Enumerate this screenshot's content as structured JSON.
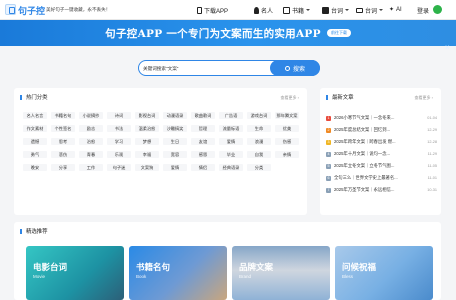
{
  "header": {
    "logo_text": "句子控",
    "tagline": "美好句子一键收藏，永不丢失！",
    "nav": {
      "download": "下载APP",
      "names": "名人",
      "books": "书籍",
      "taici": "台词",
      "taiwen": "台词",
      "ai": "AI",
      "login": "登录"
    }
  },
  "banner": {
    "title": "句子控APP 一个专门为文案而生的实用APP",
    "button": "前往下载",
    "close": "×"
  },
  "search": {
    "value": "关键词搜索\"文案\"",
    "button": "搜索"
  },
  "hot": {
    "title": "热门分类",
    "more": "查看更多 ›",
    "tags": [
      "名人名言",
      "书籍名句",
      "小说摘抄",
      "诗词",
      "影视台词",
      "动漫语录",
      "歌曲歌词",
      "广告语",
      "游戏台词",
      "",
      "那年腾文案",
      "作文素材",
      "个性签名",
      "励志",
      "书法",
      "温柔治愈",
      "沙雕搞笑",
      "哲理",
      "",
      "流量标语",
      "生命",
      "优美",
      "遗憾",
      "思考",
      "治愈",
      "学习",
      "梦想",
      "生日",
      "",
      "友谊",
      "爱情",
      "浪漫",
      "伤感",
      "勇气",
      "悲伤",
      "青春",
      "乐观",
      "幸福",
      "宽容",
      "",
      "感恩",
      "毕业",
      "自我",
      "亲情",
      "晚安",
      "分享",
      "工作",
      "句子迷",
      "文案狗",
      "",
      "爱情",
      "情侣",
      "经典语录",
      "分类"
    ]
  },
  "news": {
    "title": "最新文章",
    "more": "查看更多 ›",
    "items": [
      {
        "rank": "1",
        "title": "2026小寒节气文案｜一念冬来...",
        "date": "01-04",
        "color": "#e84b3c"
      },
      {
        "rank": "2",
        "title": "2025年度总结文案｜回忆到...",
        "date": "12-29",
        "color": "#f08a24"
      },
      {
        "rank": "3",
        "title": "2025年跨年文案｜跨春出发 燃...",
        "date": "12-28",
        "color": "#f0b624"
      },
      {
        "rank": "4",
        "title": "2025年十月文案｜说句一念...",
        "date": "11-29",
        "color": "#8aa0b6"
      },
      {
        "rank": "5",
        "title": "2025年立冬文案｜立冬节气图...",
        "date": "11-05",
        "color": "#8aa0b6"
      },
      {
        "rank": "6",
        "title": "全句三么｜世界文学史上最著名...",
        "date": "11-01",
        "color": "#8aa0b6"
      },
      {
        "rank": "7",
        "title": "2025年万圣节文案｜永远相信...",
        "date": "10-31",
        "color": "#8aa0b6"
      }
    ]
  },
  "picks": {
    "title": "精选推荐",
    "cards": [
      {
        "title": "电影台词",
        "subtitle": "Movie"
      },
      {
        "title": "书籍名句",
        "subtitle": "Book"
      },
      {
        "title": "品牌文案",
        "subtitle": "Brand"
      },
      {
        "title": "问候祝福",
        "subtitle": "Bless"
      }
    ]
  },
  "colors": {
    "accent": "#2f86e6",
    "banner": "#2a8ae6"
  }
}
